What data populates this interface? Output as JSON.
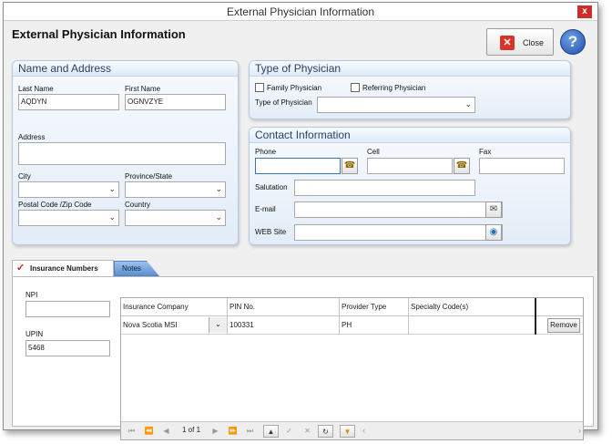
{
  "window": {
    "title": "External Physician Information",
    "close_glyph": "x"
  },
  "heading": "External Physician Information",
  "toolbar": {
    "close_label": "Close",
    "help_glyph": "?"
  },
  "name_address": {
    "title": "Name and Address",
    "last_name_label": "Last Name",
    "last_name_value": "AQDYN",
    "first_name_label": "First Name",
    "first_name_value": "OGNVZYE",
    "address_label": "Address",
    "address_value": "",
    "city_label": "City",
    "city_value": "",
    "province_label": "Province/State",
    "province_value": "",
    "postal_label": "Postal Code /Zip Code",
    "postal_value": "",
    "country_label": "Country",
    "country_value": ""
  },
  "physician_type": {
    "title": "Type of Physician",
    "family_label": "Family Physician",
    "family_checked": false,
    "referring_label": "Referring Physician",
    "referring_checked": false,
    "type_label": "Type of Physician",
    "type_value": ""
  },
  "contact": {
    "title": "Contact Information",
    "phone_label": "Phone",
    "phone_value": "",
    "cell_label": "Cell",
    "cell_value": "",
    "fax_label": "Fax",
    "fax_value": "",
    "salutation_label": "Salutation",
    "salutation_value": "",
    "email_label": "E-mail",
    "email_value": "",
    "web_label": "WEB Site",
    "web_value": ""
  },
  "tabs": [
    {
      "label": "Insurance Numbers",
      "active": true
    },
    {
      "label": "Notes",
      "active": false
    }
  ],
  "insurance": {
    "npi_label": "NPI",
    "npi_value": "",
    "upin_label": "UPIN",
    "upin_value": "5468",
    "columns": [
      "Insurance Company",
      "PIN No.",
      "Provider Type",
      "Specialty Code(s)"
    ],
    "rows": [
      {
        "company": "Nova Scotia MSI",
        "pin": "100331",
        "provider_type": "PH",
        "specialty": "",
        "action": "Remove"
      }
    ],
    "pager": "1 of 1"
  },
  "icons": {
    "phone_dial": "phone-dial-icon",
    "email_compose": "email-compose-icon",
    "web_globe": "globe-icon"
  },
  "colors": {
    "accent_blue": "#1e4fa8",
    "close_red": "#d9342b",
    "panel_border": "#b7c9e2"
  }
}
